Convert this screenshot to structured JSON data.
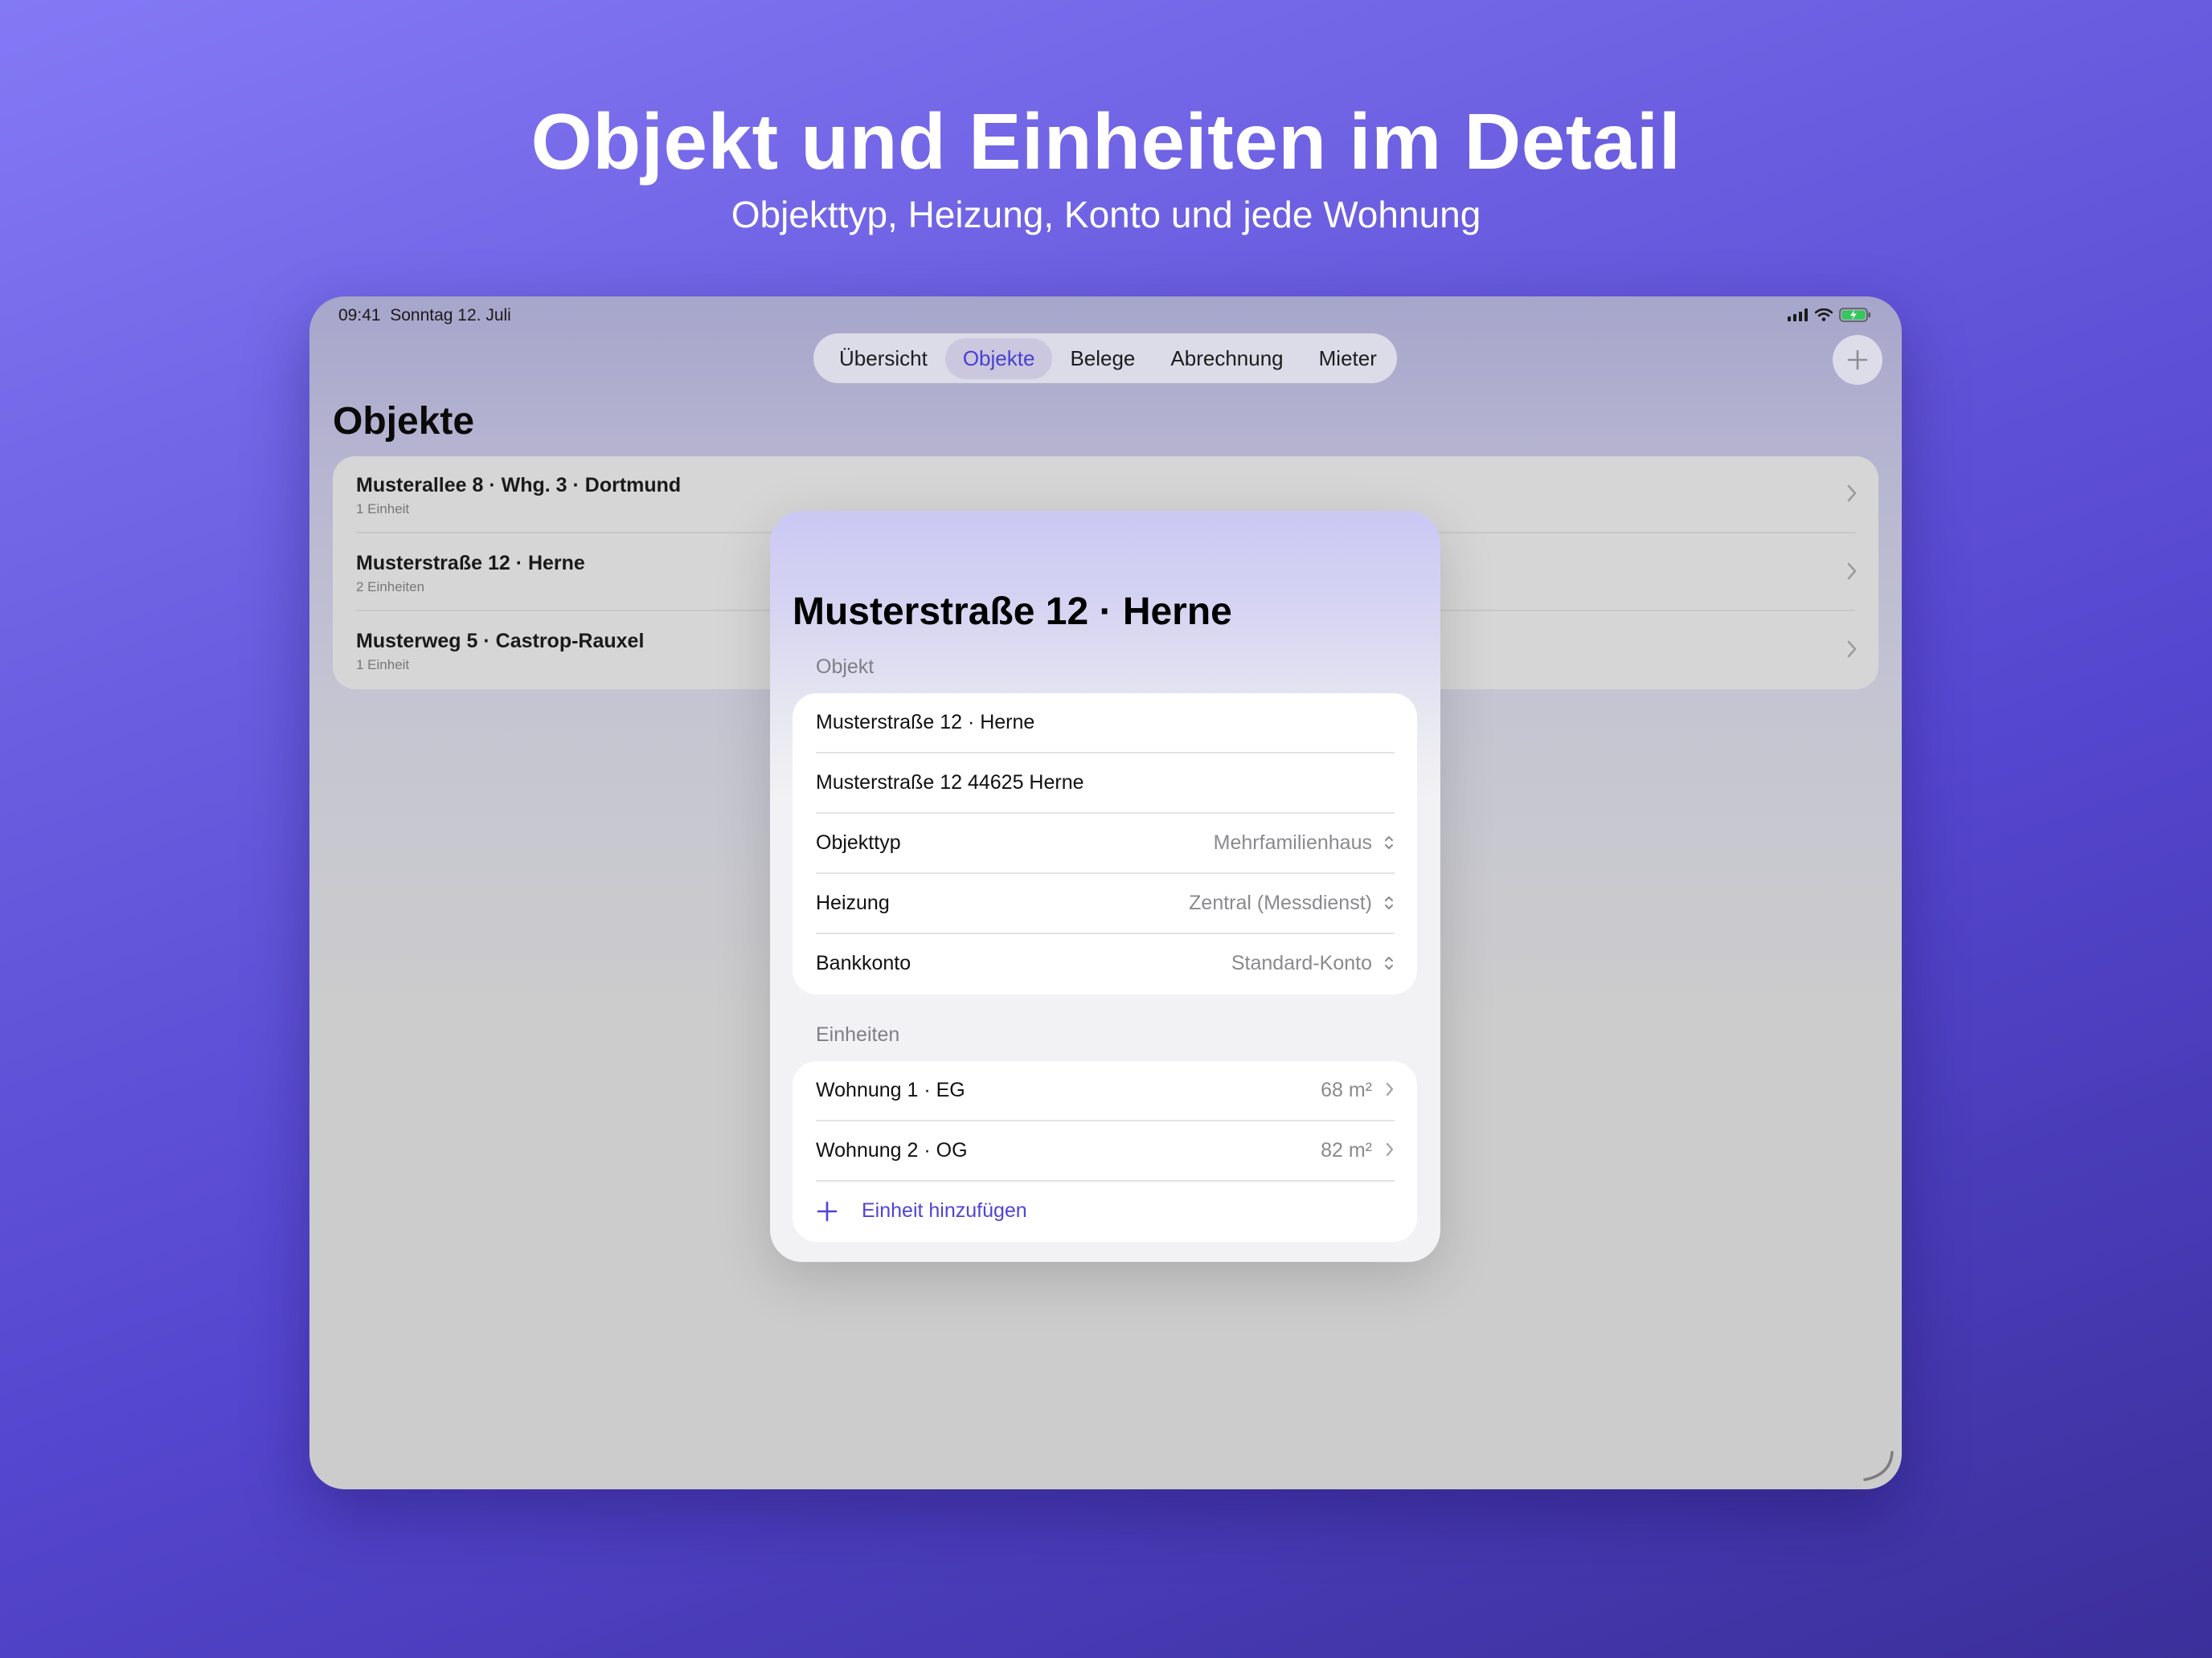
{
  "hero": {
    "title": "Objekt und Einheiten im Detail",
    "subtitle": "Objekttyp, Heizung, Konto und jede Wohnung"
  },
  "status_bar": {
    "time_date": "09:41  Sonntag 12. Juli"
  },
  "tabs": [
    {
      "label": "Übersicht"
    },
    {
      "label": "Objekte",
      "active": true
    },
    {
      "label": "Belege"
    },
    {
      "label": "Abrechnung"
    },
    {
      "label": "Mieter"
    }
  ],
  "page": {
    "title": "Objekte"
  },
  "properties": [
    {
      "title": "Musterallee 8 · Whg. 3 · Dortmund",
      "subtitle": "1 Einheit"
    },
    {
      "title": "Musterstraße 12 · Herne",
      "subtitle": "2 Einheiten"
    },
    {
      "title": "Musterweg 5 · Castrop-Rauxel",
      "subtitle": "1 Einheit"
    }
  ],
  "sheet": {
    "title": "Musterstraße 12 · Herne",
    "object_section": {
      "label": "Objekt",
      "name": "Musterstraße 12 · Herne",
      "address": "Musterstraße 12 44625 Herne",
      "fields": [
        {
          "label": "Objekttyp",
          "value": "Mehrfamilienhaus"
        },
        {
          "label": "Heizung",
          "value": "Zentral (Messdienst)"
        },
        {
          "label": "Bankkonto",
          "value": "Standard-Konto"
        }
      ]
    },
    "units_section": {
      "label": "Einheiten",
      "units": [
        {
          "label": "Wohnung 1 · EG",
          "area": "68 m²"
        },
        {
          "label": "Wohnung 2 · OG",
          "area": "82 m²"
        }
      ],
      "add_label": "Einheit hinzufügen"
    }
  },
  "colors": {
    "accent": "#4f44d6",
    "background_top": "#8479f5",
    "background_bottom": "#3b2f9a"
  },
  "icons": {
    "add": "plus-icon",
    "disclosure": "chevron-right-icon",
    "popup": "chevron-up-down-icon",
    "status": [
      "signal-icon",
      "wifi-icon",
      "battery-charging-icon"
    ]
  }
}
